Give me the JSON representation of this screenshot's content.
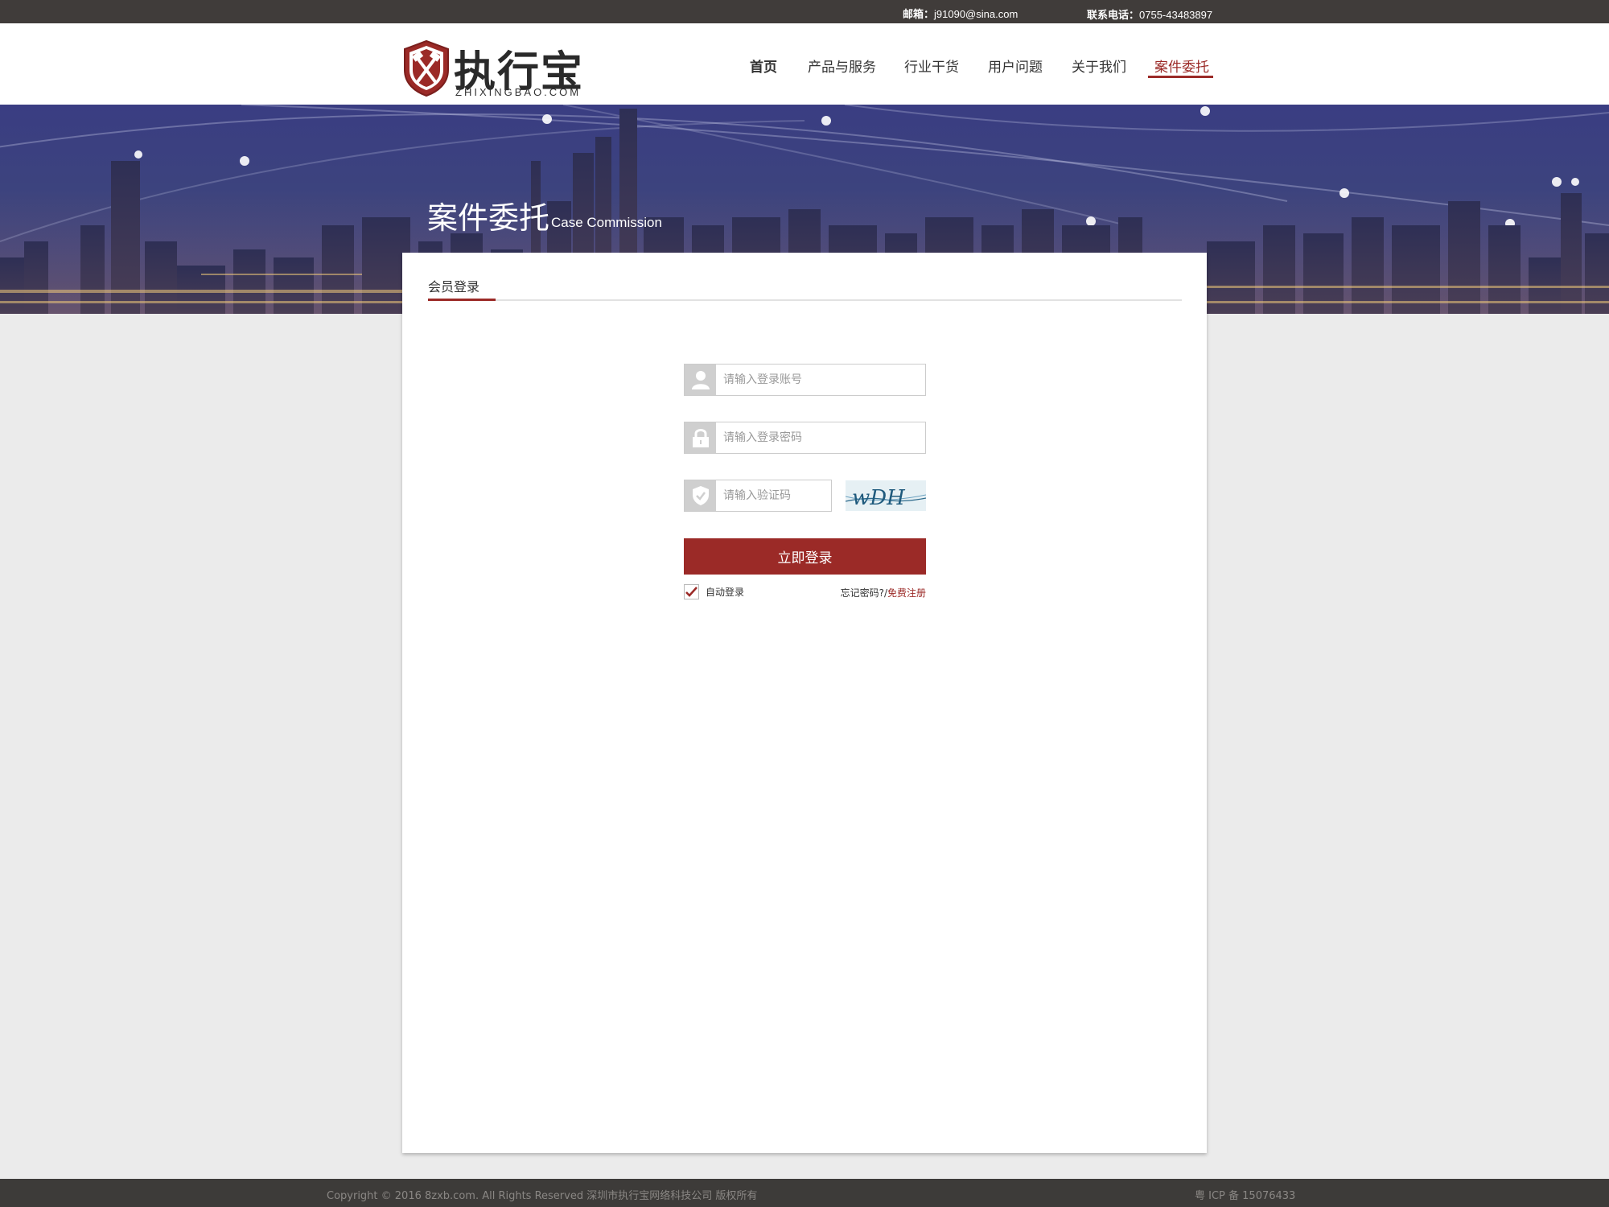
{
  "topbar": {
    "email_label": "邮箱：",
    "email_value": "j91090@sina.com",
    "phone_label": "联系电话：",
    "phone_value": "0755-43483897"
  },
  "logo": {
    "name": "执行宝",
    "domain": "ZHIXINGBAO.COM",
    "icon": "shield-hammer-icon"
  },
  "nav": {
    "items": [
      {
        "label": "首页",
        "active": false
      },
      {
        "label": "产品与服务",
        "active": false
      },
      {
        "label": "行业干货",
        "active": false
      },
      {
        "label": "用户问题",
        "active": false
      },
      {
        "label": "关于我们",
        "active": false
      },
      {
        "label": "案件委托",
        "active": true
      }
    ]
  },
  "banner": {
    "title": "案件委托",
    "subtitle": "Case Commission"
  },
  "login": {
    "tab": "会员登录",
    "account_placeholder": "请输入登录账号",
    "password_placeholder": "请输入登录密码",
    "captcha_placeholder": "请输入验证码",
    "captcha_text": "wDH",
    "submit_label": "立即登录",
    "auto_login_label": "自动登录",
    "auto_login_checked": true,
    "forgot_label": "忘记密码?",
    "separator": "/",
    "register_label": "免费注册"
  },
  "footer": {
    "copyright": "Copyright © 2016 8zxb.com. All Rights Reserved  深圳市执行宝网络科技公司 版权所有",
    "icp": "粤 ICP 备 15076433"
  },
  "colors": {
    "accent": "#9b2a27",
    "topbar": "#403c3a",
    "footer": "#3d3b39",
    "page_bg": "#ebebeb"
  }
}
